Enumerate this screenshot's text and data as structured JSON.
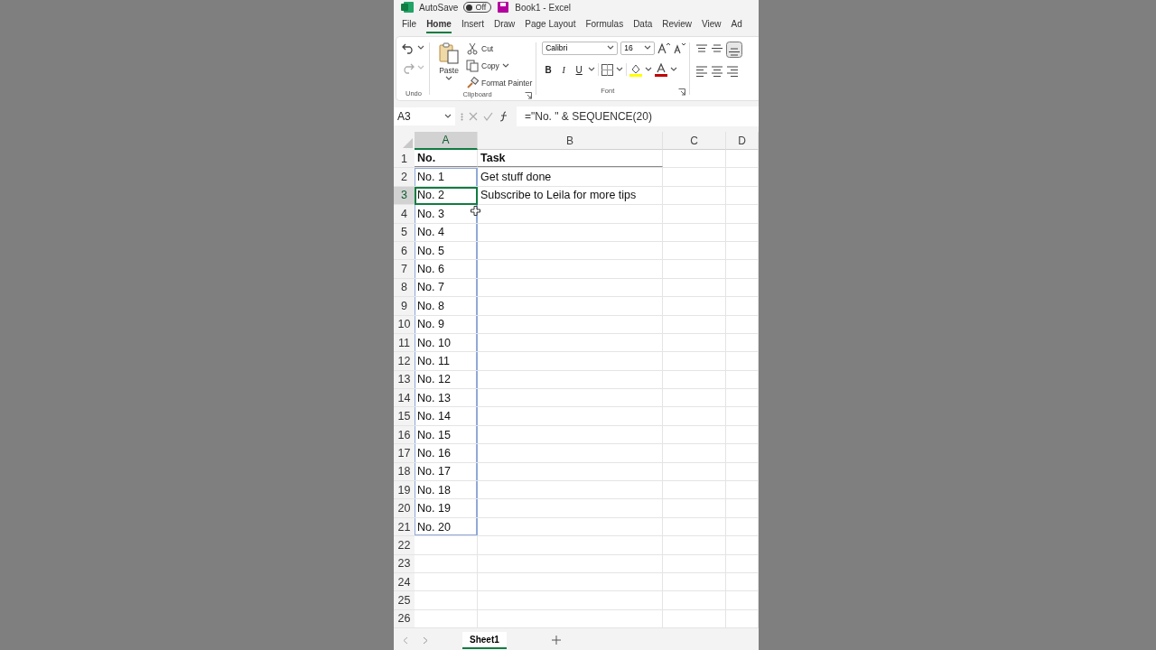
{
  "title_bar": {
    "autosave_label": "AutoSave",
    "autosave_toggle": {
      "label": "Off",
      "on": false
    },
    "document_title": "Book1 - Excel"
  },
  "ribbon_tabs": [
    {
      "label": "File",
      "selected": false
    },
    {
      "label": "Home",
      "selected": true
    },
    {
      "label": "Insert",
      "selected": false
    },
    {
      "label": "Draw",
      "selected": false
    },
    {
      "label": "Page Layout",
      "selected": false
    },
    {
      "label": "Formulas",
      "selected": false
    },
    {
      "label": "Data",
      "selected": false
    },
    {
      "label": "Review",
      "selected": false
    },
    {
      "label": "View",
      "selected": false
    },
    {
      "label": "Ad",
      "selected": false
    }
  ],
  "ribbon": {
    "undo_group": {
      "label": "Undo"
    },
    "clipboard_group": {
      "label": "Clipboard",
      "paste_label": "Paste",
      "items": [
        {
          "kind": "cut",
          "label": "Cut"
        },
        {
          "kind": "copy",
          "label": "Copy"
        },
        {
          "kind": "painter",
          "label": "Format Painter"
        }
      ]
    },
    "font_group": {
      "label": "Font",
      "font_name": "Calibri",
      "font_size": "16",
      "bold_label": "B",
      "italic_label": "I",
      "underline_label": "U"
    }
  },
  "formula_bar": {
    "name_box": "A3",
    "formula": "=\"No. \" & SEQUENCE(20)"
  },
  "sheet": {
    "columns": [
      {
        "label": "A",
        "selected": true
      },
      {
        "label": "B",
        "selected": false
      },
      {
        "label": "C",
        "selected": false
      },
      {
        "label": "D",
        "selected": false
      }
    ],
    "rows": [
      {
        "number": "1",
        "kind": "header",
        "selected": false,
        "spilled": false,
        "cells": [
          "No.",
          "Task"
        ]
      },
      {
        "number": "2",
        "kind": "data",
        "selected": false,
        "spilled": true,
        "cells": [
          "No. 1",
          "Get stuff done"
        ]
      },
      {
        "number": "3",
        "kind": "data",
        "selected": true,
        "spilled": true,
        "cells": [
          "No. 2",
          "Subscribe to Leila for more tips"
        ]
      },
      {
        "number": "4",
        "kind": "data",
        "selected": false,
        "spilled": true,
        "cells": [
          "No. 3"
        ]
      },
      {
        "number": "5",
        "kind": "data",
        "selected": false,
        "spilled": true,
        "cells": [
          "No. 4"
        ]
      },
      {
        "number": "6",
        "kind": "data",
        "selected": false,
        "spilled": true,
        "cells": [
          "No. 5"
        ]
      },
      {
        "number": "7",
        "kind": "data",
        "selected": false,
        "spilled": true,
        "cells": [
          "No. 6"
        ]
      },
      {
        "number": "8",
        "kind": "data",
        "selected": false,
        "spilled": true,
        "cells": [
          "No. 7"
        ]
      },
      {
        "number": "9",
        "kind": "data",
        "selected": false,
        "spilled": true,
        "cells": [
          "No. 8"
        ]
      },
      {
        "number": "10",
        "kind": "data",
        "selected": false,
        "spilled": true,
        "cells": [
          "No. 9"
        ]
      },
      {
        "number": "11",
        "kind": "data",
        "selected": false,
        "spilled": true,
        "cells": [
          "No. 10"
        ]
      },
      {
        "number": "12",
        "kind": "data",
        "selected": false,
        "spilled": true,
        "cells": [
          "No. 11"
        ]
      },
      {
        "number": "13",
        "kind": "data",
        "selected": false,
        "spilled": true,
        "cells": [
          "No. 12"
        ]
      },
      {
        "number": "14",
        "kind": "data",
        "selected": false,
        "spilled": true,
        "cells": [
          "No. 13"
        ]
      },
      {
        "number": "15",
        "kind": "data",
        "selected": false,
        "spilled": true,
        "cells": [
          "No. 14"
        ]
      },
      {
        "number": "16",
        "kind": "data",
        "selected": false,
        "spilled": true,
        "cells": [
          "No. 15"
        ]
      },
      {
        "number": "17",
        "kind": "data",
        "selected": false,
        "spilled": true,
        "cells": [
          "No. 16"
        ]
      },
      {
        "number": "18",
        "kind": "data",
        "selected": false,
        "spilled": true,
        "cells": [
          "No. 17"
        ]
      },
      {
        "number": "19",
        "kind": "data",
        "selected": false,
        "spilled": true,
        "cells": [
          "No. 18"
        ]
      },
      {
        "number": "20",
        "kind": "data",
        "selected": false,
        "spilled": true,
        "cells": [
          "No. 19"
        ]
      },
      {
        "number": "21",
        "kind": "data",
        "selected": false,
        "spilled": true,
        "cells": [
          "No. 20"
        ]
      },
      {
        "number": "22",
        "kind": "data",
        "selected": false,
        "spilled": false,
        "cells": []
      },
      {
        "number": "23",
        "kind": "data",
        "selected": false,
        "spilled": false,
        "cells": []
      },
      {
        "number": "24",
        "kind": "data",
        "selected": false,
        "spilled": false,
        "cells": []
      },
      {
        "number": "25",
        "kind": "data",
        "selected": false,
        "spilled": false,
        "cells": []
      },
      {
        "number": "26",
        "kind": "data",
        "selected": false,
        "spilled": false,
        "cells": []
      }
    ]
  },
  "sheet_tabs": [
    {
      "label": "Sheet1",
      "selected": true
    }
  ]
}
